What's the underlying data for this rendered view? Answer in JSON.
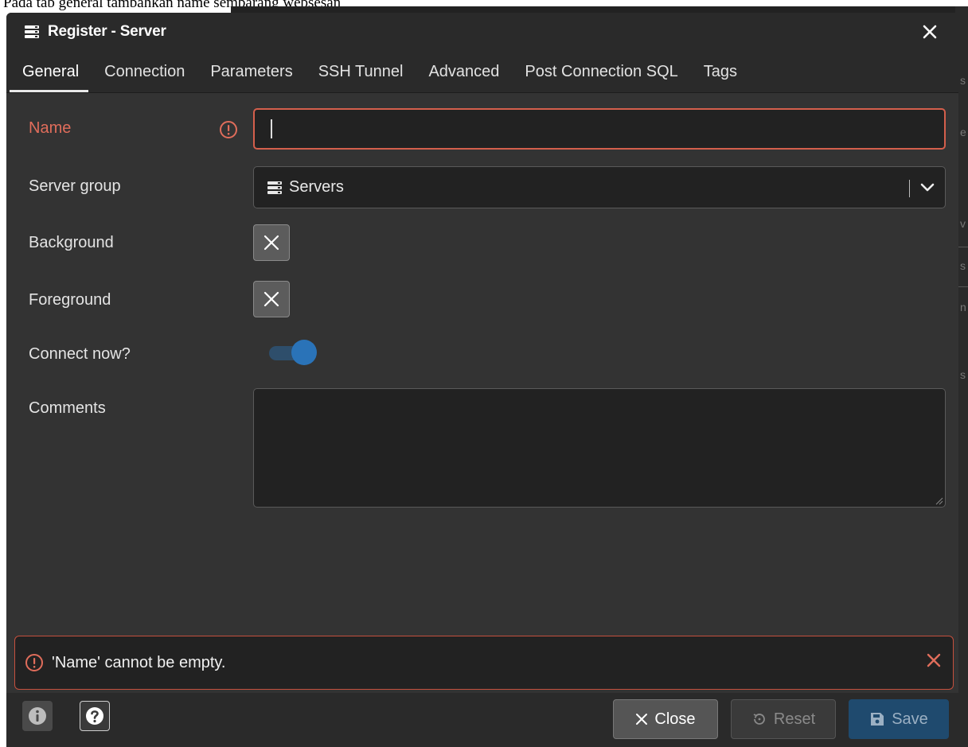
{
  "document": {
    "caption": "Pada tab general tambahkan name sembarang websesan"
  },
  "background_hints": {
    "edge_letters": [
      "s",
      "e",
      "v",
      "s",
      "n",
      "s"
    ]
  },
  "dialog": {
    "title": "Register - Server",
    "title_icon": "server-icon",
    "close_icon": "close-icon"
  },
  "tabs": [
    {
      "label": "General",
      "active": true
    },
    {
      "label": "Connection",
      "active": false
    },
    {
      "label": "Parameters",
      "active": false
    },
    {
      "label": "SSH Tunnel",
      "active": false
    },
    {
      "label": "Advanced",
      "active": false
    },
    {
      "label": "Post Connection SQL",
      "active": false
    },
    {
      "label": "Tags",
      "active": false
    }
  ],
  "form": {
    "name": {
      "label": "Name",
      "value": "",
      "state": "error",
      "icon": "alert-circle-icon"
    },
    "server_group": {
      "label": "Server group",
      "selected": "Servers",
      "icon": "server-icon"
    },
    "background": {
      "label": "Background",
      "value": "none"
    },
    "foreground": {
      "label": "Foreground",
      "value": "none"
    },
    "connect_now": {
      "label": "Connect now?",
      "checked": true
    },
    "comments": {
      "label": "Comments",
      "value": ""
    }
  },
  "error": {
    "message": "'Name' cannot be empty.",
    "icon": "alert-circle-icon",
    "dismiss_icon": "close-icon"
  },
  "footer": {
    "info_icon": "info-icon",
    "help_icon": "help-icon",
    "close_label": "Close",
    "reset_label": "Reset",
    "save_label": "Save"
  },
  "colors": {
    "error": "#e06d5b",
    "accent": "#2a73b8",
    "save_button": "#1f4a6e"
  }
}
